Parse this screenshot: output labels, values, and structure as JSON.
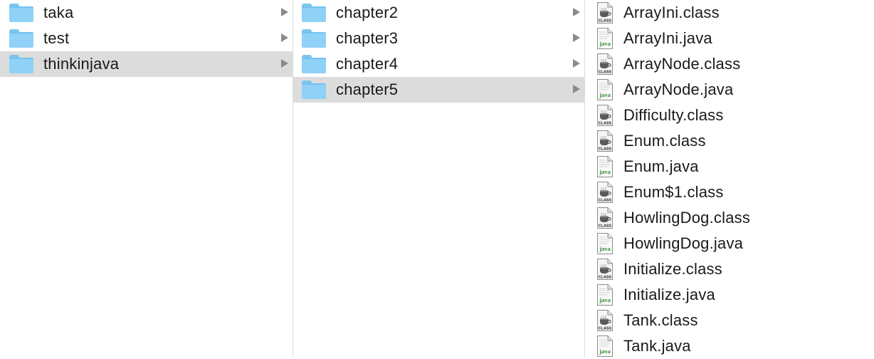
{
  "column1": {
    "items": [
      {
        "label": "taka"
      },
      {
        "label": "test"
      },
      {
        "label": "thinkinjava"
      }
    ]
  },
  "column2": {
    "items": [
      {
        "label": "chapter2"
      },
      {
        "label": "chapter3"
      },
      {
        "label": "chapter4"
      },
      {
        "label": "chapter5"
      }
    ]
  },
  "column3": {
    "items": [
      {
        "label": "ArrayIni.class",
        "icon": "class-file-icon"
      },
      {
        "label": "ArrayIni.java",
        "icon": "java-file-icon"
      },
      {
        "label": "ArrayNode.class",
        "icon": "class-file-icon"
      },
      {
        "label": "ArrayNode.java",
        "icon": "java-file-icon"
      },
      {
        "label": "Difficulty.class",
        "icon": "class-file-icon"
      },
      {
        "label": "Enum.class",
        "icon": "class-file-icon"
      },
      {
        "label": "Enum.java",
        "icon": "java-file-icon"
      },
      {
        "label": "Enum$1.class",
        "icon": "class-file-icon"
      },
      {
        "label": "HowlingDog.class",
        "icon": "class-file-icon"
      },
      {
        "label": "HowlingDog.java",
        "icon": "java-file-icon"
      },
      {
        "label": "Initialize.class",
        "icon": "class-file-icon"
      },
      {
        "label": "Initialize.java",
        "icon": "java-file-icon"
      },
      {
        "label": "Tank.class",
        "icon": "class-file-icon"
      },
      {
        "label": "Tank.java",
        "icon": "java-file-icon"
      }
    ]
  },
  "icons": {
    "class_badge": "CLASS",
    "java_badge": "java"
  },
  "colors": {
    "selection": "#dcdcdc",
    "folder": "#8fd1f7",
    "chevron": "#8a8a8a",
    "java_badge": "#2e8b2e"
  }
}
